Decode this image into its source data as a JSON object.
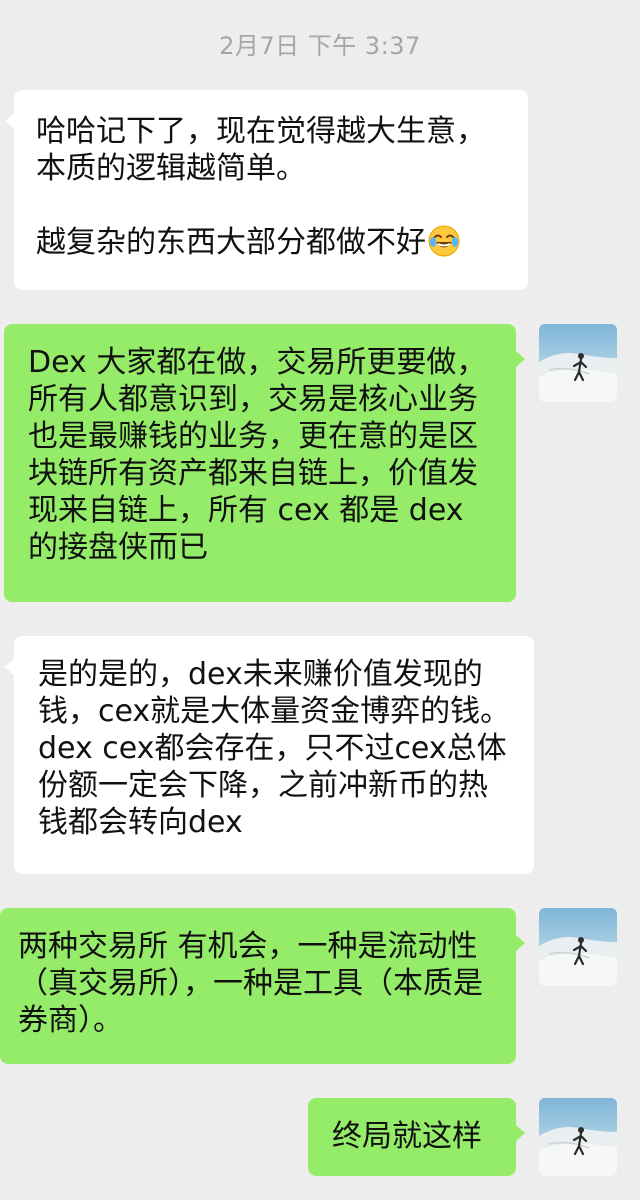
{
  "chat": {
    "timestamp": "2月7日 下午 3:37",
    "messages": [
      {
        "side": "in",
        "text": "哈哈记下了，现在觉得越大生意，\n本质的逻辑越简单。\n\n越复杂的东西大部分都做不好",
        "emoji": "face-with-tears-of-joy"
      },
      {
        "side": "out",
        "text": "Dex 大家都在做，交易所更要做，所有人都意识到，交易是核心业务也是最赚钱的业务，更在意的是区块链所有资产都来自链上，价值发现来自链上，所有 cex 都是 dex 的接盘侠而已"
      },
      {
        "side": "in",
        "text": "是的是的，dex未来赚价值发现的钱，cex就是大体量资金博弈的钱。dex cex都会存在，只不过cex总体份额一定会下降，之前冲新币的热钱都会转向dex"
      },
      {
        "side": "out",
        "text": "两种交易所 有机会，一种是流动性（真交易所），一种是工具（本质是券商）。"
      },
      {
        "side": "out",
        "text": "终局就这样"
      }
    ]
  },
  "colors": {
    "background": "#ededed",
    "incoming_bubble": "#ffffff",
    "outgoing_bubble": "#95ec69",
    "timestamp_text": "#a6a6a6"
  },
  "icons": {
    "laugh_emoji": "face-with-tears-of-joy",
    "avatar": "user-avatar-sand-dune-photo"
  }
}
